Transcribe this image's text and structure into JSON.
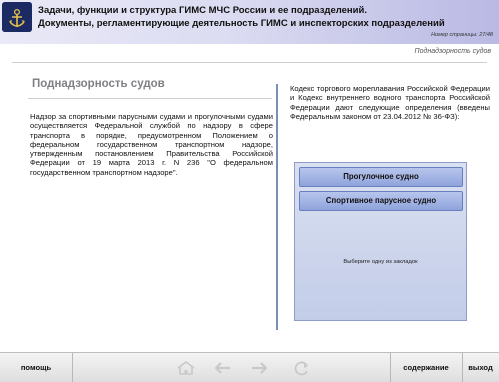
{
  "header": {
    "title_line1": "Задачи, функции и структура ГИМС МЧС России и ее подразделений.",
    "title_line2": "Документы, регламентирующие деятельность ГИМС и инспекторских подразделений",
    "page_number": "Номер страницы: 27/48",
    "section": "Поднадзорность судов",
    "emblem_icon": "emblem-anchor-icon"
  },
  "main": {
    "title": "Поднадзорность судов",
    "left_text": "Надзор за спортивными парусными судами и прогулочными судами осуществляется Федеральной службой по надзору в сфере транспорта в порядке, предусмотренном Положением о федеральном государственном транспортном надзоре, утвержденным постановлением Правительства Российской Федерации от 19 марта 2013 г. N 236 \"О федеральном государственном транспортном надзоре\".",
    "right_text": "Кодекс торгового мореплавания Российской Федерации и Кодекс внутреннего водного транспорта Российской Федерации дают следующие определения (введены Федеральным законом от 23.04.2012 № 36-ФЗ):",
    "tabs": [
      {
        "label": "Прогулочное судно"
      },
      {
        "label": "Спортивное парусное судно"
      }
    ],
    "tab_hint": "Выберите одну из закладок"
  },
  "footer": {
    "help": "помощь",
    "contents": "содержание",
    "exit": "выход",
    "icons": [
      "home-icon",
      "back-arrow-icon",
      "forward-arrow-icon",
      "refresh-icon"
    ]
  },
  "colors": {
    "header_gradient_end": "#b9b9e4",
    "tab_button": "#8fa3dc",
    "tab_box": "#c3cde8",
    "divider": "#7a8fb8"
  }
}
